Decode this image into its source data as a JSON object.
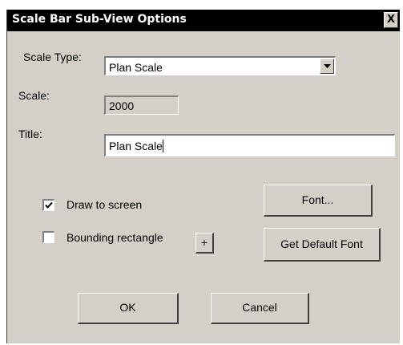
{
  "window": {
    "title": "Scale Bar Sub-View Options",
    "close_glyph": "X"
  },
  "scale_type": {
    "label": "Scale Type:",
    "value": "Plan Scale",
    "dropdown_icon": "chevron-down-icon"
  },
  "scale": {
    "label": "Scale:",
    "value": "2000"
  },
  "title_field": {
    "label": "Title:",
    "value": "Plan Scale"
  },
  "options": {
    "draw_to_screen": {
      "label": "Draw to screen",
      "checked": true
    },
    "bounding_rectangle": {
      "label": "Bounding rectangle",
      "checked": false,
      "plus_label": "+"
    }
  },
  "buttons": {
    "font": "Font...",
    "default_font": "Get Default Font",
    "ok": "OK",
    "cancel": "Cancel"
  },
  "colors": {
    "dialog_bg": "#d4d0c8",
    "titlebar_bg": "#000000",
    "titlebar_text": "#ffffff"
  }
}
